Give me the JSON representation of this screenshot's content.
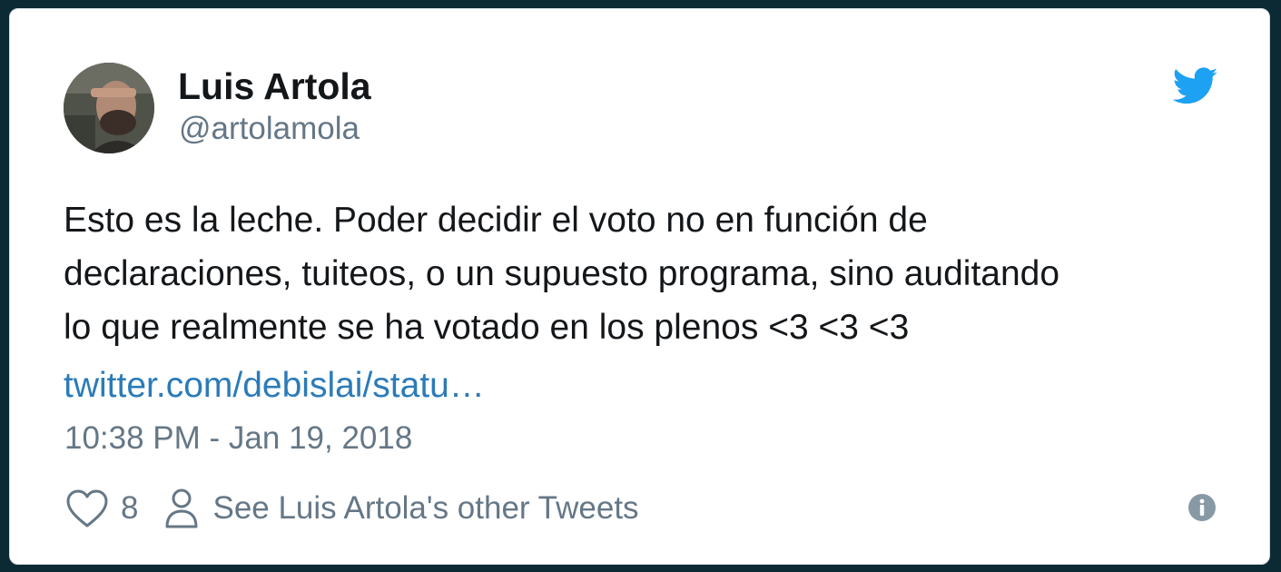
{
  "tweet": {
    "author_name": "Luis Artola",
    "author_handle": "@artolamola",
    "text_lines": [
      "Esto es la leche. Poder decidir el voto no en función de",
      "declaraciones, tuiteos, o un supuesto programa, sino auditando",
      "lo que realmente se ha votado en los plenos <3 <3 <3"
    ],
    "link_text": "twitter.com/debislai/statu…",
    "timestamp": "10:38 PM - Jan 19, 2018"
  },
  "footer": {
    "like_count": "8",
    "profile_link": "See Luis Artola's other Tweets"
  },
  "icons": {
    "brand": "twitter-bird-icon",
    "like": "heart-icon",
    "profile": "person-icon",
    "info": "info-icon"
  },
  "colors": {
    "brand_blue": "#1da1f2",
    "link_blue": "#2b7bb9",
    "text": "#14171a",
    "secondary_text": "#657786",
    "background": "#0b2a33"
  }
}
